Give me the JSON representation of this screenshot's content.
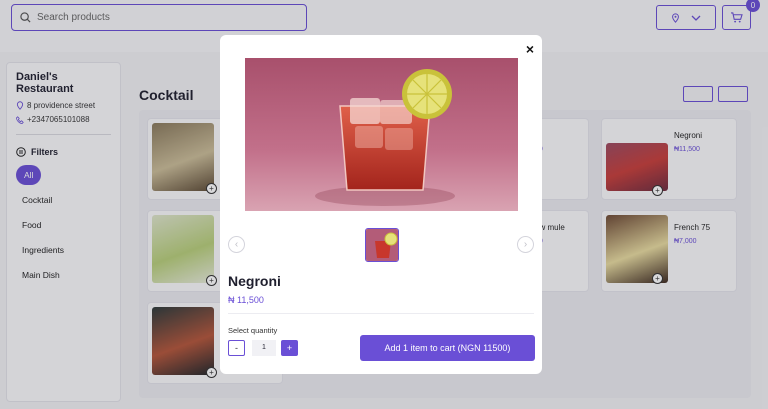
{
  "header": {
    "search_placeholder": "Search products",
    "cart_count": "0"
  },
  "sidebar": {
    "restaurant_name": "Daniel's Restaurant",
    "address": "8 providence street",
    "phone": "+2347065101088",
    "filters_label": "Filters",
    "filters": [
      {
        "label": "All",
        "active": true
      },
      {
        "label": "Cocktail",
        "active": false
      },
      {
        "label": "Food",
        "active": false
      },
      {
        "label": "Ingredients",
        "active": false
      },
      {
        "label": "Main Dish",
        "active": false
      }
    ]
  },
  "main": {
    "category_title": "Cocktail",
    "cards": [
      {
        "name": "Negroni",
        "price": "₦11,500"
      },
      {
        "name": "French 75",
        "price": "₦7,000"
      }
    ],
    "partial_cards": [
      {
        "name": "ni",
        "price": "00"
      },
      {
        "name": "ow mule",
        "price": "00"
      }
    ]
  },
  "modal": {
    "close_symbol": "×",
    "product_name": "Negroni",
    "product_price": "₦ 11,500",
    "quantity_label": "Select quantity",
    "quantity_minus": "-",
    "quantity_value": "1",
    "quantity_plus": "+",
    "add_button_label": "Add 1 item to cart (NGN 11500)",
    "prev_symbol": "‹",
    "next_symbol": "›"
  },
  "colors": {
    "accent": "#6a4fd6",
    "overlay": "rgba(40,40,50,0.18)"
  }
}
